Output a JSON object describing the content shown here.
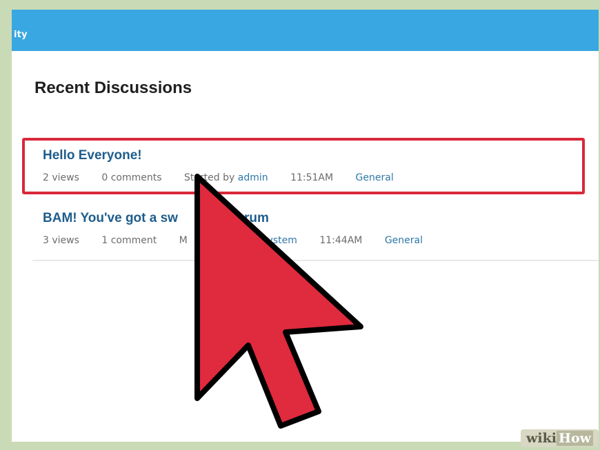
{
  "header": {
    "nav_label": "ity"
  },
  "page": {
    "title": "Recent Discussions"
  },
  "discussions": [
    {
      "title": "Hello Everyone!",
      "views": "2 views",
      "comments": "0 comments",
      "started_by_prefix": "Started by",
      "author": "admin",
      "time": "11:51AM",
      "category": "General"
    },
    {
      "title": "BAM! You've got a sw",
      "title_tail": "rum",
      "views": "3 views",
      "comments": "1 comment",
      "meta_partial": "M",
      "author": "System",
      "time": "11:44AM",
      "category": "General"
    }
  ],
  "watermark": {
    "wiki": "wiki",
    "how": "How"
  },
  "colors": {
    "header": "#39a7e1",
    "highlight": "#d9283a",
    "link": "#2f78a8",
    "title": "#1f5d8c",
    "cursor": "#e02a3d"
  },
  "icons": {
    "cursor": "pointer-arrow-icon"
  }
}
